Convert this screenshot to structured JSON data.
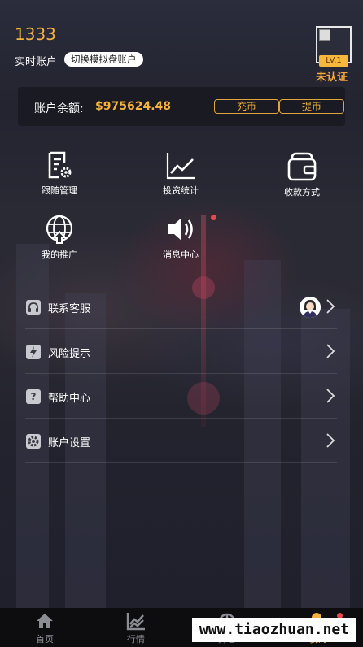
{
  "header": {
    "user_id": "1333",
    "account_type": "实时账户",
    "switch_label": "切换模拟盘账户",
    "level": "LV.1",
    "verify_status": "未认证"
  },
  "balance": {
    "label": "账户余额:",
    "value": "$975624.48",
    "deposit_label": "充币",
    "withdraw_label": "提币"
  },
  "grid": [
    {
      "label": "跟随管理",
      "icon": "document-gear-icon"
    },
    {
      "label": "投资统计",
      "icon": "line-chart-icon"
    },
    {
      "label": "收款方式",
      "icon": "wallet-icon"
    },
    {
      "label": "我的推广",
      "icon": "globe-icon"
    },
    {
      "label": "消息中心",
      "icon": "speaker-icon"
    }
  ],
  "list": [
    {
      "label": "联系客服",
      "icon": "headset-icon"
    },
    {
      "label": "风险提示",
      "icon": "lightning-icon"
    },
    {
      "label": "帮助中心",
      "icon": "question-icon"
    },
    {
      "label": "账户设置",
      "icon": "gear-icon"
    }
  ],
  "tabs": [
    {
      "label": "首页",
      "icon": "home-icon"
    },
    {
      "label": "行情",
      "icon": "market-icon"
    },
    {
      "label": "持仓",
      "icon": "position-icon"
    },
    {
      "label": "我的",
      "icon": "user-icon"
    }
  ],
  "watermark": "www.tiaozhuan.net",
  "colors": {
    "accent": "#f4b23e",
    "background": "#22232f",
    "tabbar": "#0d0d10",
    "notification": "#e84a4a"
  }
}
